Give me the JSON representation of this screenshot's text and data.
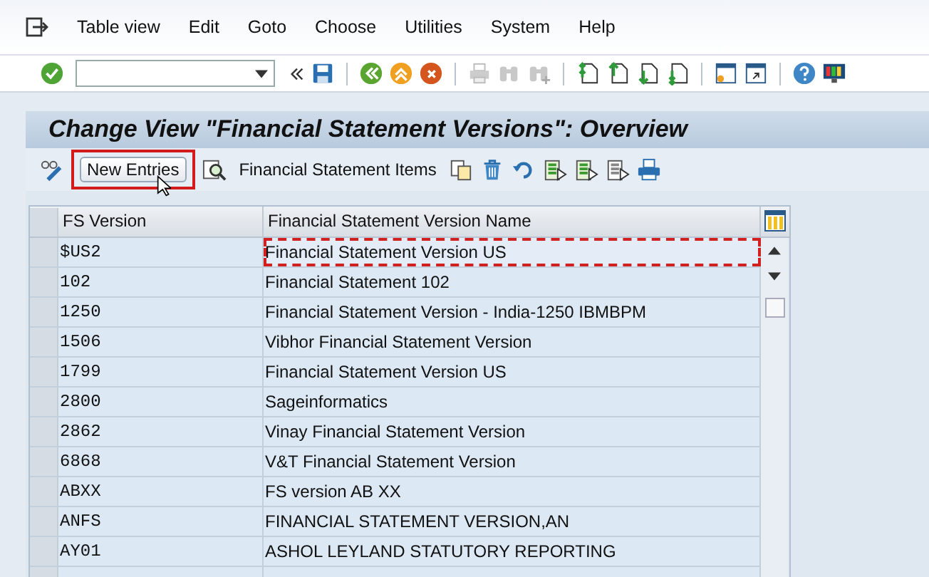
{
  "menu": [
    "Table view",
    "Edit",
    "Goto",
    "Choose",
    "Utilities",
    "System",
    "Help"
  ],
  "title": "Change View \"Financial Statement Versions\": Overview",
  "app_toolbar": {
    "new_entries": "New Entries",
    "items_button": "Financial Statement Items"
  },
  "table": {
    "columns": [
      "FS Version",
      "Financial Statement Version Name"
    ],
    "rows": [
      {
        "version": "$US2",
        "name": "Financial Statement Version US",
        "focused": true
      },
      {
        "version": "102",
        "name": "Financial Statement 102",
        "focused": false
      },
      {
        "version": "1250",
        "name": "Financial Statement Version - India-1250 IBMBPM",
        "focused": false
      },
      {
        "version": "1506",
        "name": "Vibhor Financial Statement Version",
        "focused": false
      },
      {
        "version": "1799",
        "name": "Financial Statement Version US",
        "focused": false
      },
      {
        "version": "2800",
        "name": "Sageinformatics",
        "focused": false
      },
      {
        "version": "2862",
        "name": "Vinay Financial Statement Version",
        "focused": false
      },
      {
        "version": "6868",
        "name": "V&T Financial Statement Version",
        "focused": false
      },
      {
        "version": "ABXX",
        "name": "FS version AB XX",
        "focused": false
      },
      {
        "version": "ANFS",
        "name": "FINANCIAL STATEMENT VERSION,AN",
        "focused": false
      },
      {
        "version": "AY01",
        "name": "ASHOL LEYLAND STATUTORY REPORTING",
        "focused": false
      }
    ]
  }
}
